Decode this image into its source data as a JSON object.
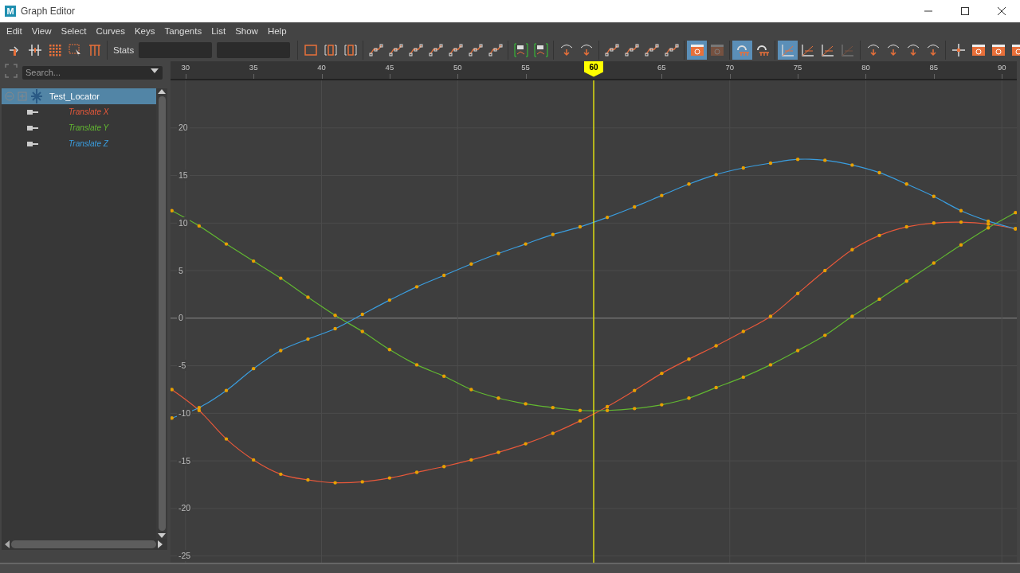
{
  "window": {
    "logo_text": "M",
    "title": "Graph Editor"
  },
  "menu": [
    "Edit",
    "View",
    "Select",
    "Curves",
    "Keys",
    "Tangents",
    "List",
    "Show",
    "Help"
  ],
  "toolbar": {
    "stats_label": "Stats",
    "groups": [
      [
        {
          "active": false,
          "disabled": false
        },
        {
          "active": false,
          "disabled": false
        },
        {
          "active": false,
          "disabled": false
        },
        {
          "active": false,
          "disabled": false
        },
        {
          "active": false,
          "disabled": false
        }
      ],
      [
        {
          "active": false,
          "disabled": false
        },
        {
          "active": false,
          "disabled": false
        },
        {
          "active": false,
          "disabled": false
        }
      ],
      [
        {
          "active": false,
          "disabled": false
        },
        {
          "active": false,
          "disabled": false
        },
        {
          "active": false,
          "disabled": false
        },
        {
          "active": false,
          "disabled": false
        },
        {
          "active": false,
          "disabled": false
        },
        {
          "active": false,
          "disabled": false
        },
        {
          "active": false,
          "disabled": false
        }
      ],
      [
        {
          "active": false,
          "disabled": false
        },
        {
          "active": false,
          "disabled": false
        }
      ],
      [
        {
          "active": false,
          "disabled": false
        },
        {
          "active": false,
          "disabled": false
        }
      ],
      [
        {
          "active": false,
          "disabled": false
        },
        {
          "active": false,
          "disabled": false
        },
        {
          "active": false,
          "disabled": false
        },
        {
          "active": false,
          "disabled": false
        }
      ],
      [
        {
          "active": true,
          "disabled": false
        },
        {
          "active": false,
          "disabled": true
        }
      ],
      [
        {
          "active": true,
          "disabled": false
        },
        {
          "active": false,
          "disabled": false
        }
      ],
      [
        {
          "active": true,
          "disabled": false
        },
        {
          "active": false,
          "disabled": false
        },
        {
          "active": false,
          "disabled": false
        },
        {
          "active": false,
          "disabled": true
        }
      ],
      [
        {
          "active": false,
          "disabled": false
        },
        {
          "active": false,
          "disabled": false
        },
        {
          "active": false,
          "disabled": false
        },
        {
          "active": false,
          "disabled": false
        }
      ]
    ],
    "right_group": [
      {
        "active": false,
        "disabled": false
      },
      {
        "active": false,
        "disabled": false
      },
      {
        "active": false,
        "disabled": false
      },
      {
        "active": false,
        "disabled": false
      }
    ]
  },
  "outliner": {
    "search": {
      "placeholder": "Search..."
    },
    "items": [
      {
        "label": "Test_Locator",
        "selected": true,
        "expanded": true
      }
    ]
  },
  "graph": {
    "chart_data": {
      "type": "line",
      "x": [
        29,
        31,
        33,
        35,
        37,
        39,
        41,
        43,
        45,
        47,
        49,
        51,
        53,
        55,
        57,
        59,
        61,
        63,
        65,
        67,
        69,
        71,
        73,
        75,
        77,
        79,
        81,
        83,
        85,
        87,
        89,
        91
      ],
      "series": [
        {
          "name": "Translate X",
          "color": "#e8583a",
          "values": [
            -7.5,
            -9.7,
            -12.7,
            -14.9,
            -16.4,
            -17.0,
            -17.3,
            -17.2,
            -16.8,
            -16.2,
            -15.6,
            -14.9,
            -14.1,
            -13.2,
            -12.1,
            -10.8,
            -9.3,
            -7.6,
            -5.8,
            -4.3,
            -2.9,
            -1.4,
            0.2,
            2.6,
            5.0,
            7.2,
            8.7,
            9.6,
            10.0,
            10.1,
            9.9,
            9.4
          ]
        },
        {
          "name": "Translate Y",
          "color": "#62b831",
          "values": [
            11.3,
            9.7,
            7.8,
            6.0,
            4.2,
            2.2,
            0.3,
            -1.4,
            -3.3,
            -4.9,
            -6.1,
            -7.5,
            -8.4,
            -9.0,
            -9.4,
            -9.7,
            -9.7,
            -9.5,
            -9.1,
            -8.4,
            -7.3,
            -6.2,
            -4.9,
            -3.4,
            -1.8,
            0.2,
            2.0,
            3.9,
            5.8,
            7.7,
            9.5,
            11.1
          ]
        },
        {
          "name": "Translate Z",
          "color": "#3a9ee0",
          "values": [
            -10.5,
            -9.4,
            -7.6,
            -5.3,
            -3.4,
            -2.2,
            -1.1,
            0.4,
            1.9,
            3.3,
            4.5,
            5.7,
            6.8,
            7.8,
            8.8,
            9.6,
            10.6,
            11.7,
            12.9,
            14.1,
            15.1,
            15.8,
            16.3,
            16.7,
            16.6,
            16.1,
            15.3,
            14.1,
            12.8,
            11.3,
            10.2,
            9.4
          ]
        }
      ],
      "xlim": [
        28.9,
        91.1
      ],
      "ylim": [
        -25.7,
        25
      ],
      "grid": true,
      "xticks": [
        30,
        35,
        40,
        45,
        50,
        55,
        65,
        70,
        75,
        80,
        85,
        90
      ],
      "yticks": [
        -25,
        -20,
        -15,
        -10,
        -5,
        0,
        5,
        10,
        15,
        20
      ],
      "ref_lines": [
        {
          "axis": "x",
          "value": 60,
          "label": "60",
          "color": "#ffff00"
        }
      ]
    }
  }
}
